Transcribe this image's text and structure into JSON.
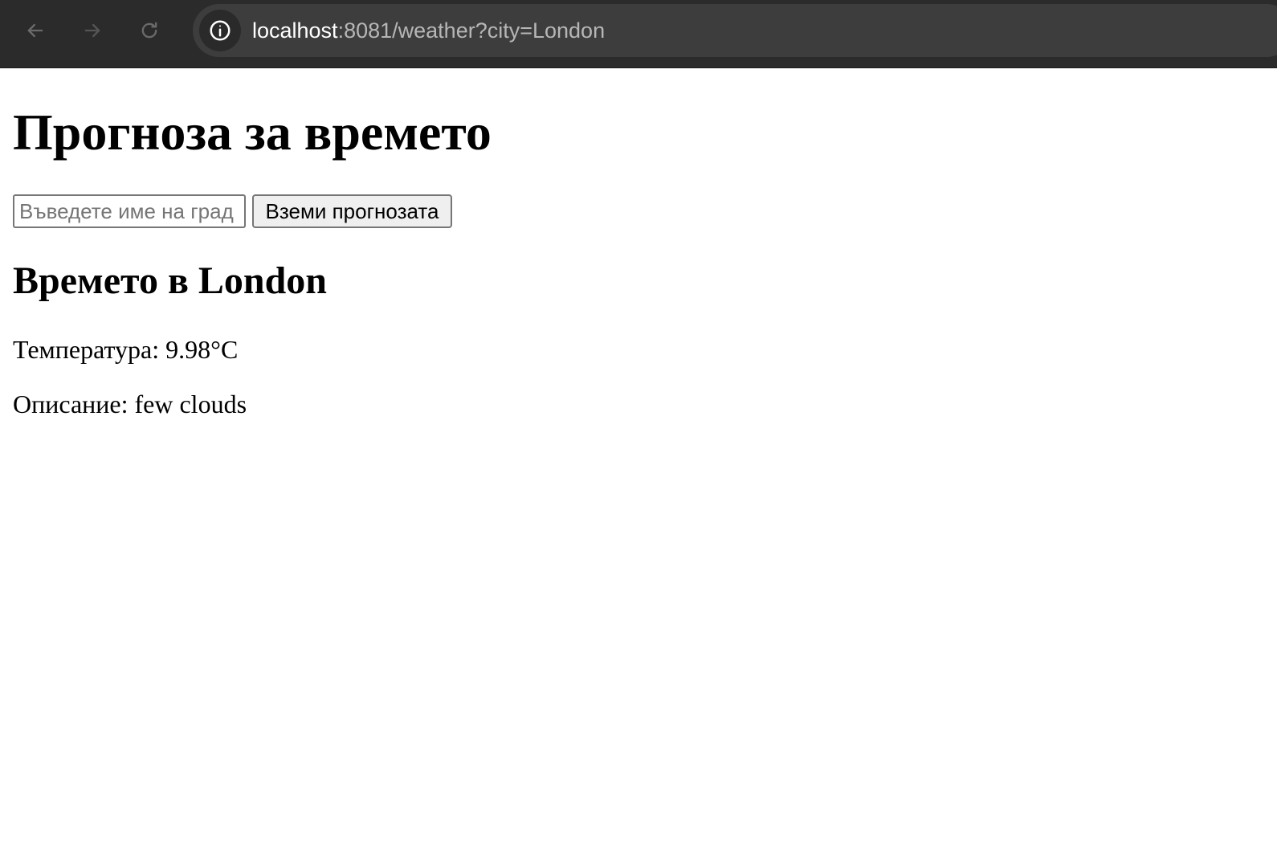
{
  "browser": {
    "url_host": "localhost",
    "url_rest": ":8081/weather?city=London",
    "icons": {
      "back": "arrow-left-icon",
      "forward": "arrow-right-icon",
      "reload": "reload-icon",
      "site_info": "info-icon"
    },
    "colors": {
      "toolbar_bg": "#2b2b2b",
      "address_bg": "#3d3d3d",
      "url_host": "#ffffff",
      "url_rest": "#b6b6b6"
    }
  },
  "page": {
    "title": "Прогноза за времето",
    "search": {
      "placeholder": "Въведете име на град",
      "value": "",
      "button_label": "Вземи прогнозата"
    },
    "result": {
      "heading": "Времето в London",
      "temperature": "Температура: 9.98°C",
      "description": "Описание: few clouds"
    }
  }
}
